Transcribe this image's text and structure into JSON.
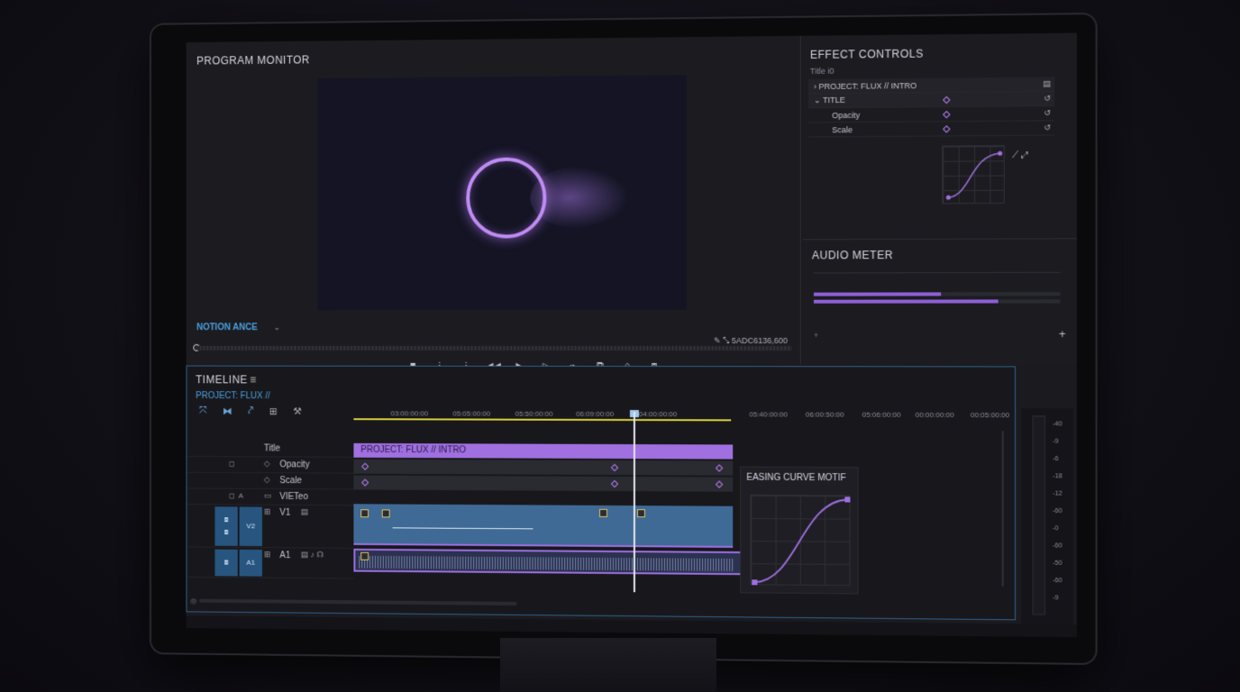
{
  "program": {
    "title": "PROGRAM MONITOR",
    "motion_label": "NOTION ANCE",
    "timecode": "5ADC6136,600",
    "transport_icons": [
      "stop-icon",
      "marker-icon",
      "marker-icon",
      "rewind-icon",
      "play-icon",
      "step-forward-icon",
      "jog-icon",
      "insert-icon",
      "overwrite-icon",
      "export-frame-icon"
    ]
  },
  "effects": {
    "title": "EFFECT CONTROLS",
    "subtitle": "Title  i0",
    "rows": [
      {
        "label": "PROJECT: FLUX // INTRO",
        "type": "head"
      },
      {
        "label": "TITLE",
        "type": "head"
      },
      {
        "label": "Opacity",
        "type": "sub"
      },
      {
        "label": "Scale",
        "type": "sub"
      }
    ]
  },
  "audio": {
    "title": "AUDIO METER",
    "levels": [
      0.52,
      0.75
    ]
  },
  "timeline": {
    "title": "TIMELINE",
    "project": "PROJECT: FLUX //",
    "ruler": [
      "03:00:00:00",
      "05:05:00:00",
      "05:50:00:00",
      "06:09:00:00",
      "04:00:00:00",
      "05:40:00:00",
      "06:00:50:00",
      "05:06:00:00",
      "00:00:00:00",
      "00:05:00:00"
    ],
    "tracks": {
      "title": "Title",
      "opacity": "Opacity",
      "scale": "Scale",
      "video": "VIETeo",
      "v1": "V1",
      "a1": "A1",
      "v2": "V2",
      "a1_cell": "A1"
    },
    "clip_title": "PROJECT: FLUX // INTRO",
    "easing_title": "EASING CURVE MOTIF"
  },
  "level_ticks": [
    "-40",
    "-9",
    "-6",
    "-18",
    "-12",
    "-60",
    "-0",
    "-60",
    "-50",
    "-60",
    "-9"
  ],
  "colors": {
    "accent": "#a06fe0",
    "blue": "#4aa0e0"
  }
}
